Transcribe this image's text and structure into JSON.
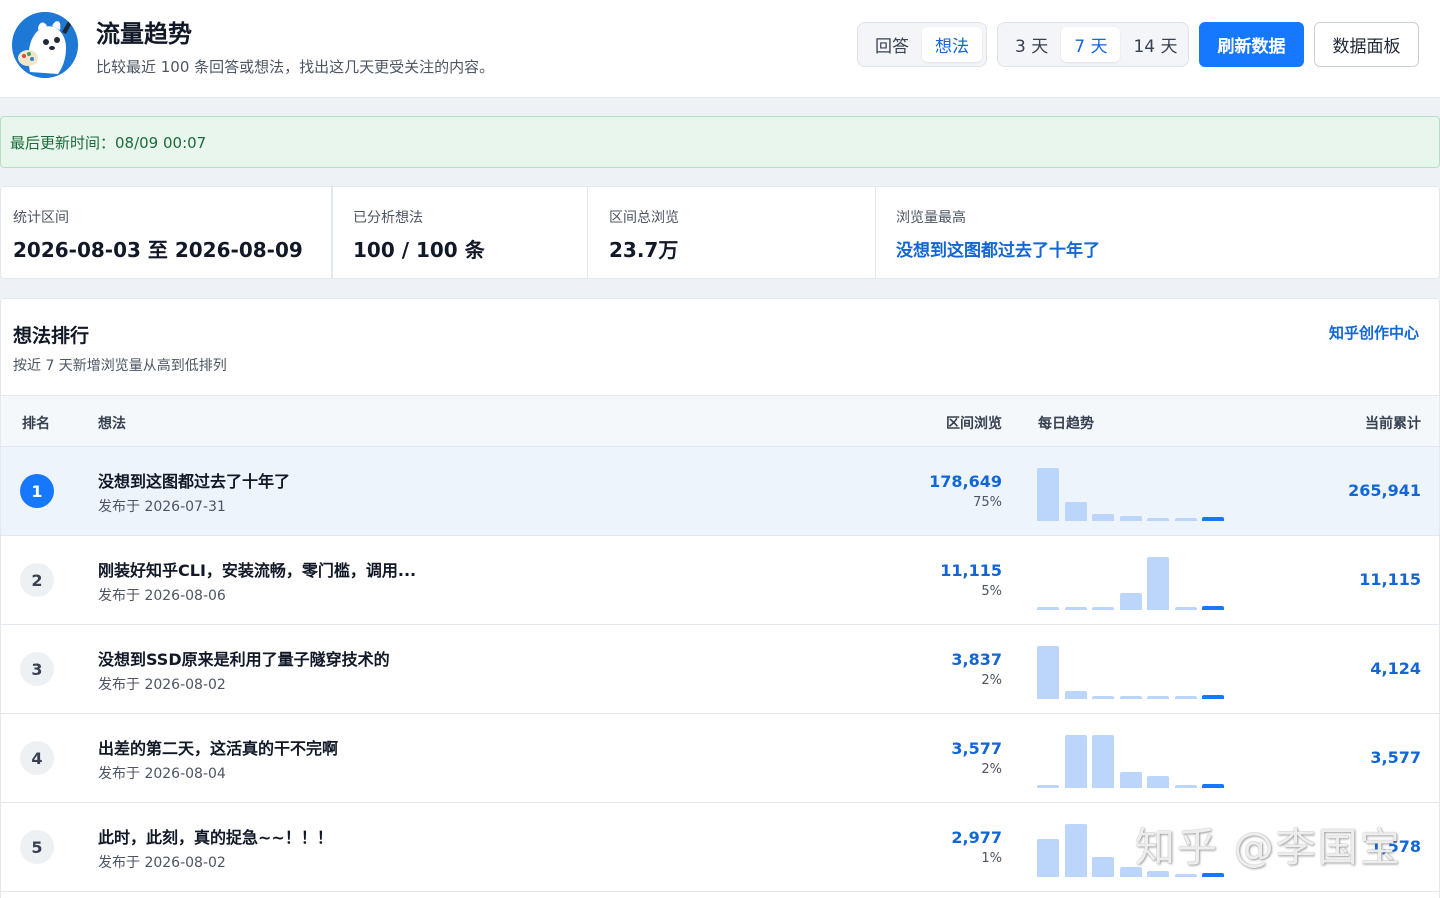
{
  "header": {
    "title": "流量趋势",
    "subtitle": "比较最近 100 条回答或想法，找出这几天更受关注的内容。",
    "type_tabs": [
      {
        "label": "回答",
        "active": false
      },
      {
        "label": "想法",
        "active": true
      }
    ],
    "range_tabs": [
      {
        "label": "3 天",
        "active": false
      },
      {
        "label": "7 天",
        "active": true
      },
      {
        "label": "14 天",
        "active": false
      }
    ],
    "refresh_label": "刷新数据",
    "dashboard_label": "数据面板"
  },
  "update_notice": "最后更新时间：08/09 00:07",
  "stats": {
    "period_label": "统计区间",
    "period_value": "2026-08-03 至 2026-08-09",
    "analyzed_label": "已分析想法",
    "analyzed_value": "100 / 100 条",
    "total_views_label": "区间总浏览",
    "total_views_value": "23.7万",
    "top_label": "浏览量最高",
    "top_value": "没想到这图都过去了十年了"
  },
  "ranking": {
    "title": "想法排行",
    "subtitle": "按近 7 天新增浏览量从高到低排列",
    "link_label": "知乎创作中心",
    "columns": {
      "rank": "排名",
      "post": "想法",
      "views": "区间浏览",
      "trend": "每日趋势",
      "total": "当前累计"
    },
    "rows": [
      {
        "rank": "1",
        "title": "没想到这图都过去了十年了",
        "date": "发布于 2026-07-31",
        "views": "178,649",
        "pct": "75%",
        "total": "265,941",
        "trend": [
          100,
          35,
          14,
          9,
          6,
          6,
          8
        ]
      },
      {
        "rank": "2",
        "title": "刚装好知乎CLI，安装流畅，零门槛，调用...",
        "date": "发布于 2026-08-06",
        "views": "11,115",
        "pct": "5%",
        "total": "11,115",
        "trend": [
          6,
          6,
          6,
          33,
          100,
          6,
          8
        ]
      },
      {
        "rank": "3",
        "title": "没想到SSD原来是利用了量子隧穿技术的",
        "date": "发布于 2026-08-02",
        "views": "3,837",
        "pct": "2%",
        "total": "4,124",
        "trend": [
          100,
          15,
          6,
          6,
          6,
          6,
          8
        ]
      },
      {
        "rank": "4",
        "title": "出差的第二天，这活真的干不完啊",
        "date": "发布于 2026-08-04",
        "views": "3,577",
        "pct": "2%",
        "total": "3,577",
        "trend": [
          6,
          100,
          100,
          30,
          22,
          6,
          8
        ]
      },
      {
        "rank": "5",
        "title": "此时，此刻，真的捉急~~！！！",
        "date": "发布于 2026-08-02",
        "views": "2,977",
        "pct": "1%",
        "total": "1,578",
        "trend": [
          72,
          100,
          37,
          19,
          12,
          6,
          8
        ]
      }
    ]
  },
  "watermark": "知乎 @李国宝",
  "colors": {
    "accent": "#1677ff",
    "link": "#1266d6",
    "bar_light": "#bcd6fb",
    "notice_bg": "#e9f6ee"
  }
}
